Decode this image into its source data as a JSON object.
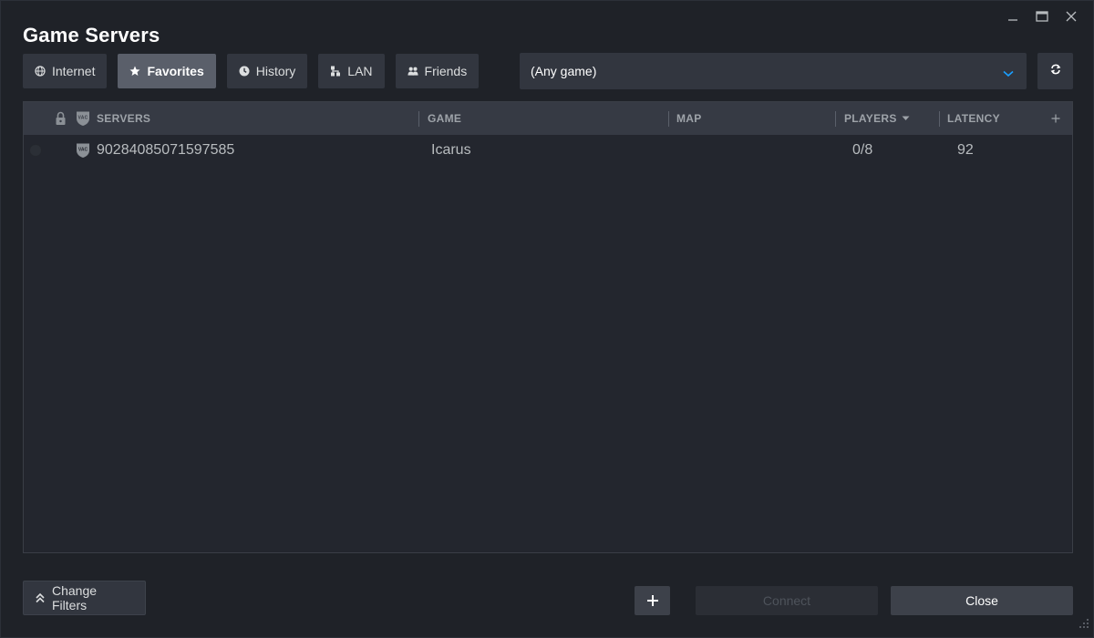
{
  "window": {
    "title": "Game Servers",
    "controls": {
      "minimize": "minimize-icon",
      "maximize": "maximize-icon",
      "close": "close-icon"
    }
  },
  "tabs": [
    {
      "label": "Internet",
      "icon": "globe-icon",
      "active": false
    },
    {
      "label": "Favorites",
      "icon": "star-icon",
      "active": true
    },
    {
      "label": "History",
      "icon": "clock-icon",
      "active": false
    },
    {
      "label": "LAN",
      "icon": "lan-icon",
      "active": false
    },
    {
      "label": "Friends",
      "icon": "friends-icon",
      "active": false
    }
  ],
  "game_filter": {
    "selected": "(Any game)"
  },
  "table": {
    "columns": {
      "servers": "SERVERS",
      "game": "GAME",
      "map": "MAP",
      "players": "PLAYERS",
      "latency": "LATENCY"
    },
    "sort_column": "players",
    "rows": [
      {
        "server": "90284085071597585",
        "game": "Icarus",
        "map": "",
        "players": "0/8",
        "latency": "92"
      }
    ]
  },
  "footer": {
    "change_filters": "Change Filters",
    "connect": "Connect",
    "close": "Close"
  },
  "colors": {
    "background": "#1f2228",
    "button": "#32363f",
    "active_tab": "#5a5f6a",
    "accent": "#1a9fff"
  }
}
